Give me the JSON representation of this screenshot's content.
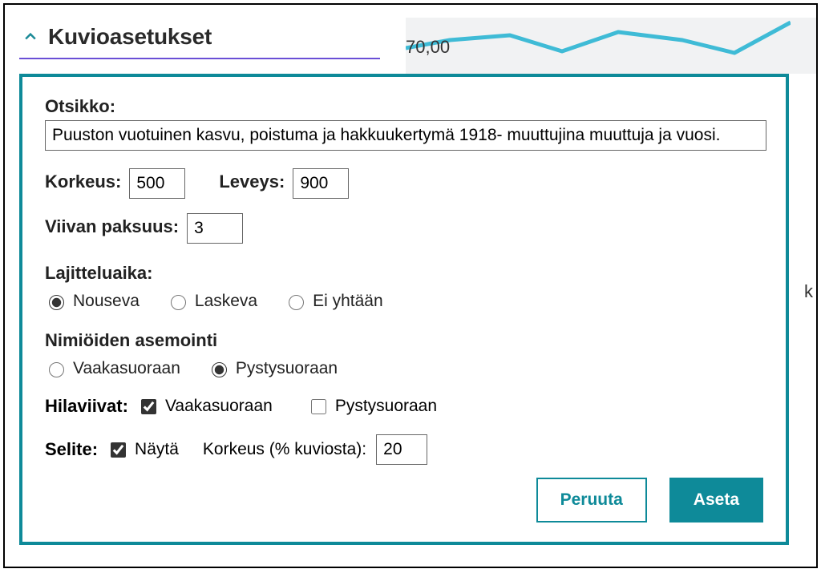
{
  "header": {
    "title": "Kuvioasetukset"
  },
  "background": {
    "y_tick": "70,00",
    "right_marker": "k"
  },
  "form": {
    "otsikko_label": "Otsikko:",
    "otsikko_value": "Puuston vuotuinen kasvu, poistuma ja hakkuukertymä 1918- muuttujina muuttuja ja vuosi.",
    "korkeus_label": "Korkeus:",
    "korkeus_value": "500",
    "leveys_label": "Leveys:",
    "leveys_value": "900",
    "viivan_paksuus_label": "Viivan paksuus:",
    "viivan_paksuus_value": "3",
    "lajitteluaika_label": "Lajitteluaika:",
    "sort": {
      "nouseva": "Nouseva",
      "laskeva": "Laskeva",
      "ei_yhtaan": "Ei yhtään"
    },
    "nimioiden_label": "Nimiöiden asemointi",
    "orient": {
      "vaaka": "Vaakasuoraan",
      "pysty": "Pystysuoraan"
    },
    "hilaviivat_label": "Hilaviivat:",
    "grid": {
      "vaaka": "Vaakasuoraan",
      "pysty": "Pystysuoraan"
    },
    "selite_label": "Selite:",
    "selite_nayta": "Näytä",
    "selite_korkeus_label": "Korkeus (% kuviosta):",
    "selite_korkeus_value": "20"
  },
  "buttons": {
    "cancel": "Peruuta",
    "apply": "Aseta"
  }
}
